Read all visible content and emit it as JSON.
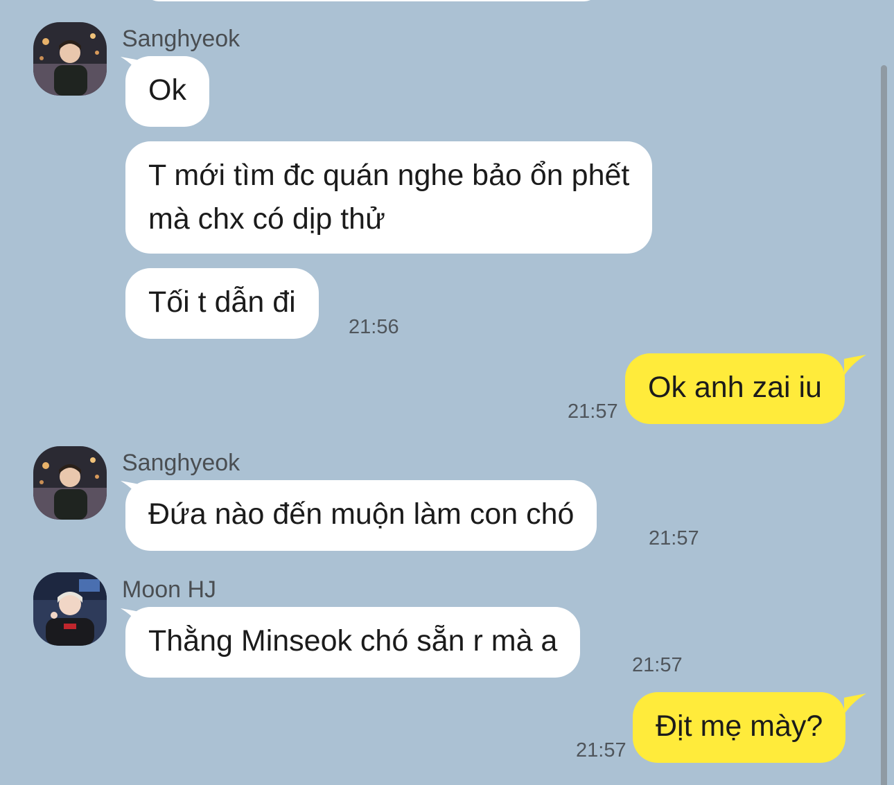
{
  "colors": {
    "background": "#abc1d3",
    "incoming_bubble": "#ffffff",
    "outgoing_bubble": "#ffeb3b",
    "timestamp_text": "#4f555b",
    "sender_text": "#4a4e52"
  },
  "messages": [
    {
      "sender": "Sanghyeok",
      "text": "Ok"
    },
    {
      "text_lines": [
        "T mới tìm đc quán nghe bảo ổn phết",
        "mà chx có dịp thử"
      ]
    },
    {
      "text": "Tối t dẫn đi",
      "time": "21:56"
    },
    {
      "text": "Ok anh zai iu",
      "time": "21:57"
    },
    {
      "sender": "Sanghyeok",
      "text": "Đứa nào đến muộn làm con chó",
      "time": "21:57"
    },
    {
      "sender": "Moon HJ",
      "text": "Thằng Minseok chó sẵn r mà a",
      "time": "21:57"
    },
    {
      "text": "Địt mẹ mày?",
      "time": "21:57"
    }
  ]
}
